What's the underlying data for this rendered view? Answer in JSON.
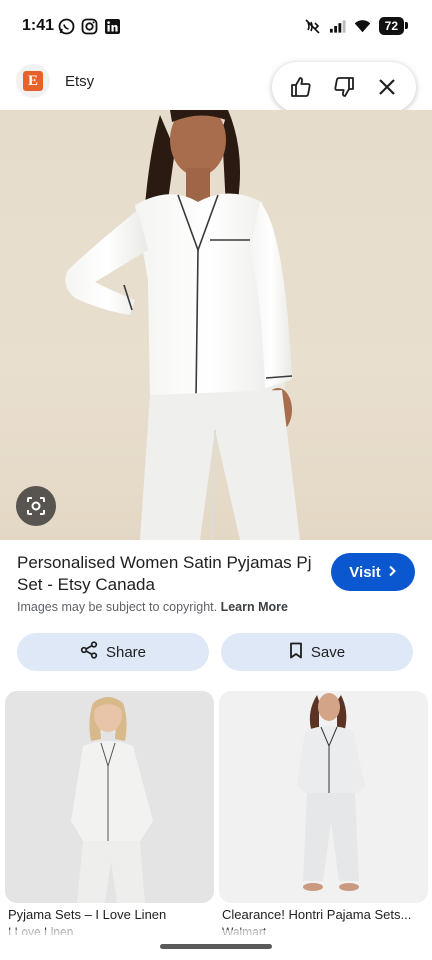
{
  "status_bar": {
    "time": "1:41",
    "app_icons": [
      "whatsapp-icon",
      "instagram-icon",
      "linkedin-icon"
    ],
    "battery": "72"
  },
  "source": {
    "logo_letter": "E",
    "name": "Etsy"
  },
  "feedback": {
    "icons": [
      "thumbs-up-icon",
      "thumbs-down-icon",
      "close-icon"
    ]
  },
  "result": {
    "title": "Personalised Women Satin Pyjamas Pj Set - Etsy Canada",
    "visit_label": "Visit",
    "copyright_text": "Images may be subject to copyright.",
    "learn_more": "Learn More"
  },
  "actions": {
    "share_label": "Share",
    "save_label": "Save"
  },
  "related": [
    {
      "caption": "Pyjama Sets – I Love Linen",
      "source": "I Love Linen"
    },
    {
      "caption": "Clearance! Hontri Pajama Sets...",
      "source": "Walmart"
    }
  ],
  "colors": {
    "accent": "#0b57d0",
    "chip_background": "#dfe8f7",
    "etsy_orange": "#e7622a"
  }
}
